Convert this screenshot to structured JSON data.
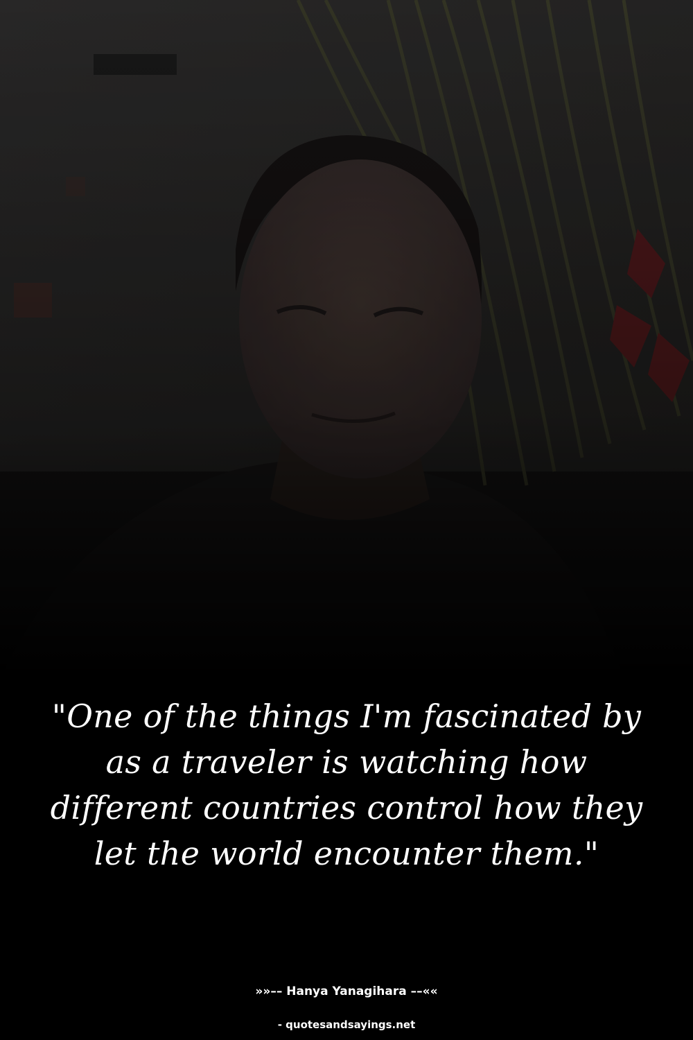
{
  "quote": {
    "text": "\"One of the things I'm fascinated by as a traveler is watching how different countries control how they let the world encounter them.\""
  },
  "attribution": {
    "author": "»»–– Hanya Yanagihara ––««"
  },
  "watermark": {
    "source": "- quotesandsayings.net"
  },
  "colors": {
    "background": "#000000",
    "text": "#ffffff"
  }
}
